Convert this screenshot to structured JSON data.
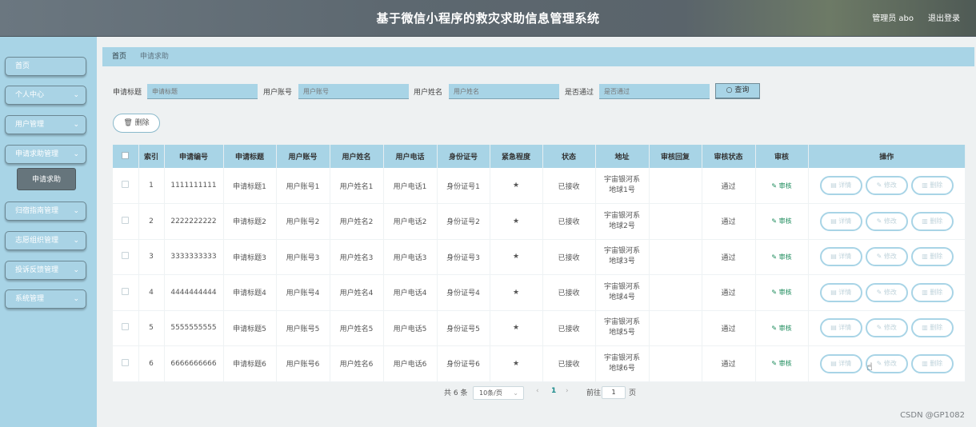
{
  "header": {
    "title": "基于微信小程序的救灾求助信息管理系统",
    "user": "管理员 abo",
    "logout": "退出登录"
  },
  "sidebar": {
    "items": [
      {
        "label": "首页",
        "chevron": ""
      },
      {
        "label": "个人中心",
        "chevron": "⌄"
      },
      {
        "label": "用户管理",
        "chevron": "⌄"
      },
      {
        "label": "申请求助管理",
        "chevron": "⌄"
      },
      {
        "label": "归宿指南管理",
        "chevron": "⌄"
      },
      {
        "label": "志愿组织管理",
        "chevron": "⌄"
      },
      {
        "label": "投诉反馈管理",
        "chevron": "⌄"
      },
      {
        "label": "系统管理",
        "chevron": "⌄"
      }
    ],
    "active_sub": "申请求助"
  },
  "breadcrumb": {
    "home": "首页",
    "current": "申请求助"
  },
  "search": {
    "labels": [
      "申请标题",
      "用户账号",
      "用户姓名",
      "是否通过"
    ],
    "placeholders": [
      "申请标题",
      "用户账号",
      "用户姓名",
      "是否通过"
    ],
    "query_button": "查询"
  },
  "actions": {
    "delete": "删除"
  },
  "table": {
    "headers": [
      "索引",
      "申请编号",
      "申请标题",
      "用户账号",
      "用户姓名",
      "用户电话",
      "身份证号",
      "紧急程度",
      "状态",
      "地址",
      "审核回复",
      "审核状态",
      "审核",
      "操作"
    ],
    "rows": [
      {
        "idx": "1",
        "no": "1111111111",
        "title": "申请标题1",
        "account": "用户账号1",
        "name": "用户姓名1",
        "phone": "用户电话1",
        "id": "身份证号1",
        "level": "★",
        "status": "已接收",
        "addr1": "宇宙银河系",
        "addr2": "地球1号",
        "reply": "",
        "audit": "通过",
        "audit_link": "审核"
      },
      {
        "idx": "2",
        "no": "2222222222",
        "title": "申请标题2",
        "account": "用户账号2",
        "name": "用户姓名2",
        "phone": "用户电话2",
        "id": "身份证号2",
        "level": "★",
        "status": "已接收",
        "addr1": "宇宙银河系",
        "addr2": "地球2号",
        "reply": "",
        "audit": "通过",
        "audit_link": "审核"
      },
      {
        "idx": "3",
        "no": "3333333333",
        "title": "申请标题3",
        "account": "用户账号3",
        "name": "用户姓名3",
        "phone": "用户电话3",
        "id": "身份证号3",
        "level": "★",
        "status": "已接收",
        "addr1": "宇宙银河系",
        "addr2": "地球3号",
        "reply": "",
        "audit": "通过",
        "audit_link": "审核"
      },
      {
        "idx": "4",
        "no": "4444444444",
        "title": "申请标题4",
        "account": "用户账号4",
        "name": "用户姓名4",
        "phone": "用户电话4",
        "id": "身份证号4",
        "level": "★",
        "status": "已接收",
        "addr1": "宇宙银河系",
        "addr2": "地球4号",
        "reply": "",
        "audit": "通过",
        "audit_link": "审核"
      },
      {
        "idx": "5",
        "no": "5555555555",
        "title": "申请标题5",
        "account": "用户账号5",
        "name": "用户姓名5",
        "phone": "用户电话5",
        "id": "身份证号5",
        "level": "★",
        "status": "已接收",
        "addr1": "宇宙银河系",
        "addr2": "地球5号",
        "reply": "",
        "audit": "通过",
        "audit_link": "审核"
      },
      {
        "idx": "6",
        "no": "6666666666",
        "title": "申请标题6",
        "account": "用户账号6",
        "name": "用户姓名6",
        "phone": "用户电话6",
        "id": "身份证号6",
        "level": "★",
        "status": "已接收",
        "addr1": "宇宙银河系",
        "addr2": "地球6号",
        "reply": "",
        "audit": "通过",
        "audit_link": "审核"
      }
    ],
    "row_buttons": {
      "detail": "详情",
      "edit": "修改",
      "delete": "删除"
    }
  },
  "pagination": {
    "total": "共 6 条",
    "page_size": "10条/页",
    "prev": "‹",
    "current": "1",
    "next": "›",
    "goto_label": "前往",
    "goto_value": "1",
    "page_unit": "页"
  },
  "watermark": "CSDN @GP1082",
  "colors": {
    "accent": "#a8d4e6",
    "audit_green": "#1a8a5a"
  }
}
